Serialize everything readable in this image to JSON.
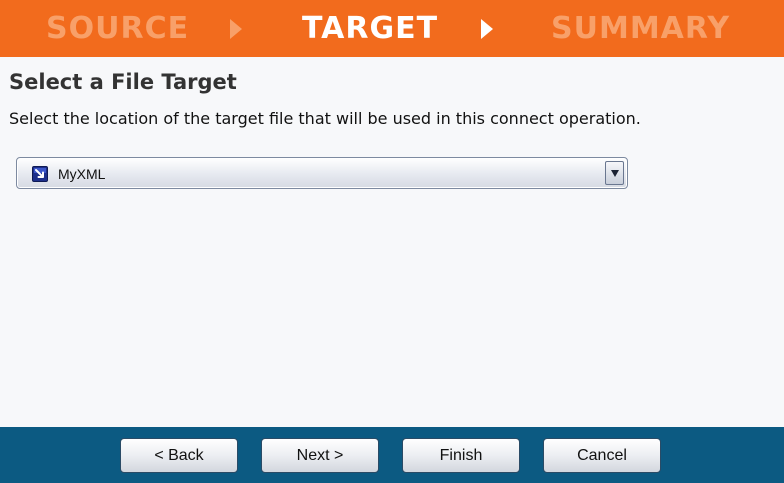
{
  "steps": {
    "source": "SOURCE",
    "target": "TARGET",
    "summary": "SUMMARY",
    "active": "target"
  },
  "page": {
    "title": "Select a File Target",
    "description": "Select the location of the target file that will be used in this connect operation."
  },
  "target_select": {
    "selected": "MyXML",
    "icon": "xml-target-icon"
  },
  "footer": {
    "back_label": "< Back",
    "next_label": "Next >",
    "finish_label": "Finish",
    "cancel_label": "Cancel"
  },
  "colors": {
    "header_bg": "#f26b1d",
    "step_inactive": "#f8a069",
    "step_active": "#ffffff",
    "footer_bg": "#0c5a82",
    "content_bg": "#f7f8fa"
  }
}
